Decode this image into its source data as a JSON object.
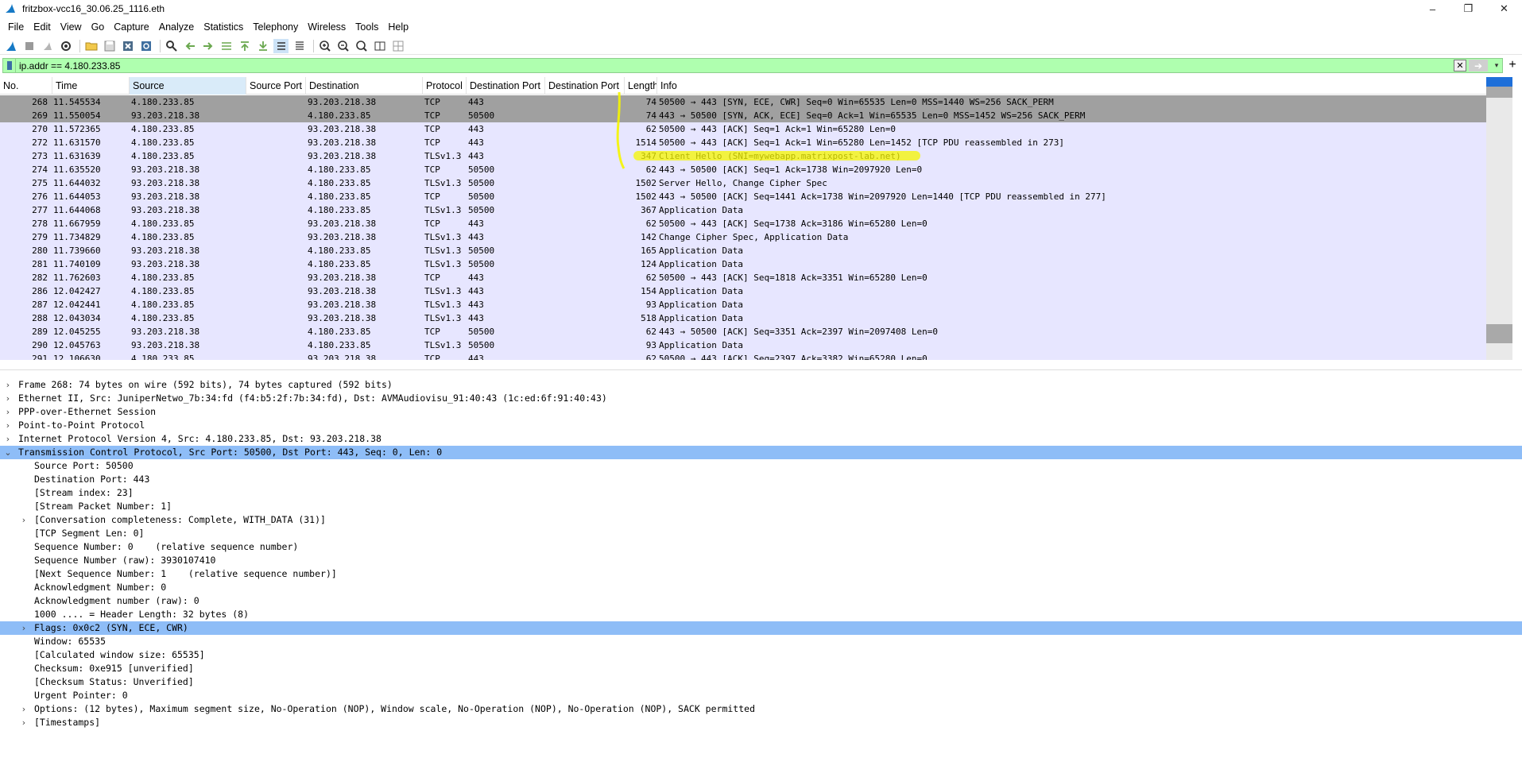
{
  "window": {
    "title": "fritzbox-vcc16_30.06.25_1116.eth",
    "minimize": "–",
    "maximize": "❐",
    "close": "✕"
  },
  "menu": [
    "File",
    "Edit",
    "View",
    "Go",
    "Capture",
    "Analyze",
    "Statistics",
    "Telephony",
    "Wireless",
    "Tools",
    "Help"
  ],
  "toolbar_icons": [
    "shark-fin-start-icon",
    "stop-icon",
    "restart-icon",
    "options-gear-icon",
    "open-folder-icon",
    "save-icon",
    "close-file-icon",
    "reload-icon",
    "find-icon",
    "go-back-icon",
    "go-forward-icon",
    "go-to-packet-icon",
    "first-packet-icon",
    "last-packet-icon",
    "autoscroll-icon",
    "colorize-icon",
    "zoom-in-icon",
    "zoom-out-icon",
    "zoom-normal-icon",
    "resize-columns-icon",
    "layout-icon"
  ],
  "filter": {
    "value": "ip.addr == 4.180.233.85",
    "clear": "✕",
    "apply": "➔",
    "dropdown": "▾",
    "add": "+"
  },
  "columns": [
    "No.",
    "Time",
    "Source",
    "Source Port",
    "Destination",
    "Protocol",
    "Destination Port",
    "Destination Port",
    "Length",
    "Info"
  ],
  "packets": [
    {
      "no": "268",
      "time": "11.545534",
      "src": "4.180.233.85",
      "dst": "93.203.218.38",
      "proto": "TCP",
      "dport": "443",
      "len": "74",
      "info": "50500 → 443 [SYN, ECE, CWR] Seq=0 Win=65535 Len=0 MSS=1440 WS=256 SACK_PERM",
      "selected": true
    },
    {
      "no": "269",
      "time": "11.550054",
      "src": "93.203.218.38",
      "dst": "4.180.233.85",
      "proto": "TCP",
      "dport": "50500",
      "len": "74",
      "info": "443 → 50500 [SYN, ACK, ECE] Seq=0 Ack=1 Win=65535 Len=0 MSS=1452 WS=256 SACK_PERM",
      "selected": true
    },
    {
      "no": "270",
      "time": "11.572365",
      "src": "4.180.233.85",
      "dst": "93.203.218.38",
      "proto": "TCP",
      "dport": "443",
      "len": "62",
      "info": "50500 → 443 [ACK] Seq=1 Ack=1 Win=65280 Len=0"
    },
    {
      "no": "272",
      "time": "11.631570",
      "src": "4.180.233.85",
      "dst": "93.203.218.38",
      "proto": "TCP",
      "dport": "443",
      "len": "1514",
      "info": "50500 → 443 [ACK] Seq=1 Ack=1 Win=65280 Len=1452 [TCP PDU reassembled in 273]"
    },
    {
      "no": "273",
      "time": "11.631639",
      "src": "4.180.233.85",
      "dst": "93.203.218.38",
      "proto": "TLSv1.3",
      "dport": "443",
      "len": "347",
      "info": "Client Hello (SNI=mywebapp.matrixpost-lab.net)"
    },
    {
      "no": "274",
      "time": "11.635520",
      "src": "93.203.218.38",
      "dst": "4.180.233.85",
      "proto": "TCP",
      "dport": "50500",
      "len": "62",
      "info": "443 → 50500 [ACK] Seq=1 Ack=1738 Win=2097920 Len=0"
    },
    {
      "no": "275",
      "time": "11.644032",
      "src": "93.203.218.38",
      "dst": "4.180.233.85",
      "proto": "TLSv1.3",
      "dport": "50500",
      "len": "1502",
      "info": "Server Hello, Change Cipher Spec"
    },
    {
      "no": "276",
      "time": "11.644053",
      "src": "93.203.218.38",
      "dst": "4.180.233.85",
      "proto": "TCP",
      "dport": "50500",
      "len": "1502",
      "info": "443 → 50500 [ACK] Seq=1441 Ack=1738 Win=2097920 Len=1440 [TCP PDU reassembled in 277]"
    },
    {
      "no": "277",
      "time": "11.644068",
      "src": "93.203.218.38",
      "dst": "4.180.233.85",
      "proto": "TLSv1.3",
      "dport": "50500",
      "len": "367",
      "info": "Application Data"
    },
    {
      "no": "278",
      "time": "11.667959",
      "src": "4.180.233.85",
      "dst": "93.203.218.38",
      "proto": "TCP",
      "dport": "443",
      "len": "62",
      "info": "50500 → 443 [ACK] Seq=1738 Ack=3186 Win=65280 Len=0"
    },
    {
      "no": "279",
      "time": "11.734829",
      "src": "4.180.233.85",
      "dst": "93.203.218.38",
      "proto": "TLSv1.3",
      "dport": "443",
      "len": "142",
      "info": "Change Cipher Spec, Application Data"
    },
    {
      "no": "280",
      "time": "11.739660",
      "src": "93.203.218.38",
      "dst": "4.180.233.85",
      "proto": "TLSv1.3",
      "dport": "50500",
      "len": "165",
      "info": "Application Data"
    },
    {
      "no": "281",
      "time": "11.740109",
      "src": "93.203.218.38",
      "dst": "4.180.233.85",
      "proto": "TLSv1.3",
      "dport": "50500",
      "len": "124",
      "info": "Application Data"
    },
    {
      "no": "282",
      "time": "11.762603",
      "src": "4.180.233.85",
      "dst": "93.203.218.38",
      "proto": "TCP",
      "dport": "443",
      "len": "62",
      "info": "50500 → 443 [ACK] Seq=1818 Ack=3351 Win=65280 Len=0"
    },
    {
      "no": "286",
      "time": "12.042427",
      "src": "4.180.233.85",
      "dst": "93.203.218.38",
      "proto": "TLSv1.3",
      "dport": "443",
      "len": "154",
      "info": "Application Data"
    },
    {
      "no": "287",
      "time": "12.042441",
      "src": "4.180.233.85",
      "dst": "93.203.218.38",
      "proto": "TLSv1.3",
      "dport": "443",
      "len": "93",
      "info": "Application Data"
    },
    {
      "no": "288",
      "time": "12.043034",
      "src": "4.180.233.85",
      "dst": "93.203.218.38",
      "proto": "TLSv1.3",
      "dport": "443",
      "len": "518",
      "info": "Application Data"
    },
    {
      "no": "289",
      "time": "12.045255",
      "src": "93.203.218.38",
      "dst": "4.180.233.85",
      "proto": "TCP",
      "dport": "50500",
      "len": "62",
      "info": "443 → 50500 [ACK] Seq=3351 Ack=2397 Win=2097408 Len=0"
    },
    {
      "no": "290",
      "time": "12.045763",
      "src": "93.203.218.38",
      "dst": "4.180.233.85",
      "proto": "TLSv1.3",
      "dport": "50500",
      "len": "93",
      "info": "Application Data"
    },
    {
      "no": "291",
      "time": "12.106630",
      "src": "4.180.233.85",
      "dst": "93.203.218.38",
      "proto": "TCP",
      "dport": "443",
      "len": "62",
      "info": "50500 → 443 [ACK] Seq=2397 Ack=3382 Win=65280 Len=0"
    }
  ],
  "details": [
    {
      "indent": 0,
      "expander": "collapsed",
      "text": "Frame 268: 74 bytes on wire (592 bits), 74 bytes captured (592 bits)"
    },
    {
      "indent": 0,
      "expander": "collapsed",
      "text": "Ethernet II, Src: JuniperNetwo_7b:34:fd (f4:b5:2f:7b:34:fd), Dst: AVMAudiovisu_91:40:43 (1c:ed:6f:91:40:43)"
    },
    {
      "indent": 0,
      "expander": "collapsed",
      "text": "PPP-over-Ethernet Session"
    },
    {
      "indent": 0,
      "expander": "collapsed",
      "text": "Point-to-Point Protocol"
    },
    {
      "indent": 0,
      "expander": "collapsed",
      "text": "Internet Protocol Version 4, Src: 4.180.233.85, Dst: 93.203.218.38"
    },
    {
      "indent": 0,
      "expander": "expanded",
      "text": "Transmission Control Protocol, Src Port: 50500, Dst Port: 443, Seq: 0, Len: 0",
      "highlight": true
    },
    {
      "indent": 1,
      "expander": "none",
      "text": "Source Port: 50500"
    },
    {
      "indent": 1,
      "expander": "none",
      "text": "Destination Port: 443"
    },
    {
      "indent": 1,
      "expander": "none",
      "text": "[Stream index: 23]"
    },
    {
      "indent": 1,
      "expander": "none",
      "text": "[Stream Packet Number: 1]"
    },
    {
      "indent": 1,
      "expander": "collapsed",
      "text": "[Conversation completeness: Complete, WITH_DATA (31)]"
    },
    {
      "indent": 1,
      "expander": "none",
      "text": "[TCP Segment Len: 0]"
    },
    {
      "indent": 1,
      "expander": "none",
      "text": "Sequence Number: 0    (relative sequence number)"
    },
    {
      "indent": 1,
      "expander": "none",
      "text": "Sequence Number (raw): 3930107410"
    },
    {
      "indent": 1,
      "expander": "none",
      "text": "[Next Sequence Number: 1    (relative sequence number)]"
    },
    {
      "indent": 1,
      "expander": "none",
      "text": "Acknowledgment Number: 0"
    },
    {
      "indent": 1,
      "expander": "none",
      "text": "Acknowledgment number (raw): 0"
    },
    {
      "indent": 1,
      "expander": "none",
      "text": "1000 .... = Header Length: 32 bytes (8)"
    },
    {
      "indent": 1,
      "expander": "collapsed",
      "text": "Flags: 0x0c2 (SYN, ECE, CWR)",
      "highlight": true
    },
    {
      "indent": 1,
      "expander": "none",
      "text": "Window: 65535"
    },
    {
      "indent": 1,
      "expander": "none",
      "text": "[Calculated window size: 65535]"
    },
    {
      "indent": 1,
      "expander": "none",
      "text": "Checksum: 0xe915 [unverified]"
    },
    {
      "indent": 1,
      "expander": "none",
      "text": "[Checksum Status: Unverified]"
    },
    {
      "indent": 1,
      "expander": "none",
      "text": "Urgent Pointer: 0"
    },
    {
      "indent": 1,
      "expander": "collapsed",
      "text": "Options: (12 bytes), Maximum segment size, No-Operation (NOP), Window scale, No-Operation (NOP), No-Operation (NOP), SACK permitted"
    },
    {
      "indent": 1,
      "expander": "collapsed",
      "text": "[Timestamps]"
    }
  ],
  "colors": {
    "filter_bg": "#afffaf",
    "row_bg": "#e7e6ff",
    "row_selected": "#a0a0a0",
    "detail_highlight": "#8ebdf7",
    "annotation": "#f5f500"
  },
  "glyphs": {
    "expanded": "⌄",
    "collapsed": "›"
  }
}
